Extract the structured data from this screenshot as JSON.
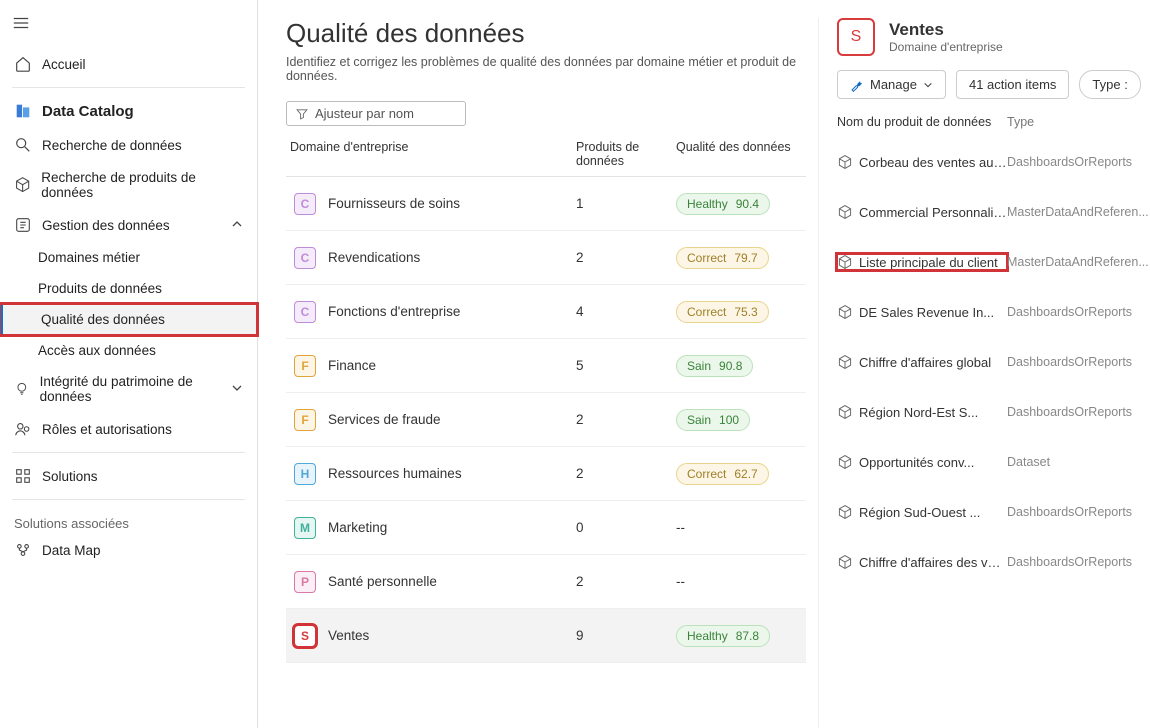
{
  "nav": {
    "accueil": "Accueil",
    "catalog": "Data Catalog",
    "search_data": "Recherche de données",
    "search_products": "Recherche de produits de données",
    "manage_data": "Gestion des données",
    "sub_business_domains": "Domaines métier",
    "sub_data_products": "Produits de données",
    "sub_data_quality": "Qualité des données",
    "sub_data_access": "Accès aux données",
    "patrimony": "Intégrité du patrimoine de données",
    "roles": "Rôles et autorisations",
    "solutions": "Solutions",
    "assoc_label": "Solutions associées",
    "data_map": "Data Map"
  },
  "page": {
    "title": "Qualité des données",
    "subtitle": "Identifiez et corrigez les problèmes de qualité des données par domaine métier et produit de données.",
    "filter_placeholder": "Ajusteur par nom"
  },
  "columns": {
    "domain": "Domaine d'entreprise",
    "products": "Produits de données",
    "quality": "Qualité des données"
  },
  "rows": [
    {
      "letter": "C",
      "color": "#c08bd8",
      "bg": "#f5ecfb",
      "name": "Fournisseurs de soins",
      "count": "1",
      "pill": "green",
      "pill_label": "Healthy",
      "score": "90.4"
    },
    {
      "letter": "C",
      "color": "#c08bd8",
      "bg": "#f5ecfb",
      "name": "Revendications",
      "count": "2",
      "pill": "yellow",
      "pill_label": "Correct",
      "score": "79.7"
    },
    {
      "letter": "C",
      "color": "#c08bd8",
      "bg": "#f5ecfb",
      "name": "Fonctions d'entreprise",
      "count": "4",
      "pill": "yellow",
      "pill_label": "Correct",
      "score": "75.3"
    },
    {
      "letter": "F",
      "color": "#e0a53a",
      "bg": "#fdf5e6",
      "name": "Finance",
      "count": "5",
      "pill": "green",
      "pill_label": "Sain",
      "score": "90.8"
    },
    {
      "letter": "F",
      "color": "#e0a53a",
      "bg": "#fdf5e6",
      "name": "Services de fraude",
      "count": "2",
      "pill": "green",
      "pill_label": "Sain",
      "score": "100"
    },
    {
      "letter": "H",
      "color": "#4fa8d8",
      "bg": "#e8f4fb",
      "name": "Ressources humaines",
      "count": "2",
      "pill": "yellow",
      "pill_label": "Correct",
      "score": "62.7"
    },
    {
      "letter": "M",
      "color": "#3fb19b",
      "bg": "#e6f6f3",
      "name": "Marketing",
      "count": "0",
      "pill": null,
      "pill_label": "--",
      "score": ""
    },
    {
      "letter": "P",
      "color": "#d67aa8",
      "bg": "#fbeef5",
      "name": "Santé personnelle",
      "count": "2",
      "pill": null,
      "pill_label": "--",
      "score": ""
    },
    {
      "letter": "S",
      "color": "#d83b3b",
      "bg": "#ffffff",
      "name": "Ventes",
      "count": "9",
      "pill": "green",
      "pill_label": "Healthy",
      "score": "87.8",
      "selected": true,
      "highlight": true
    }
  ],
  "right": {
    "header_letter": "S",
    "title": "Ventes",
    "subtitle": "Domaine d'entreprise",
    "manage": "Manage",
    "actions": "41 action items",
    "typebtn": "Type :",
    "col_name": "Nom du produit de données",
    "col_type": "Type",
    "items": [
      {
        "name": "Corbeau des ventes au Canada",
        "type": "DashboardsOrReports"
      },
      {
        "name": "Commercial Personnalisé",
        "type": "MasterDataAndReferen..."
      },
      {
        "name": "Liste principale du client",
        "type": "MasterDataAndReferen...",
        "highlight": true
      },
      {
        "name": "DE Sales Revenue In...",
        "type": "DashboardsOrReports"
      },
      {
        "name": "Chiffre d'affaires global",
        "type": "DashboardsOrReports"
      },
      {
        "name": "Région Nord-Est S...",
        "type": "DashboardsOrReports"
      },
      {
        "name": "Opportunités conv...",
        "type": "Dataset"
      },
      {
        "name": "Région Sud-Ouest ...",
        "type": "DashboardsOrReports"
      },
      {
        "name": "Chiffre d'affaires des ventes aux États-Unis en...",
        "type": "DashboardsOrReports"
      }
    ]
  }
}
